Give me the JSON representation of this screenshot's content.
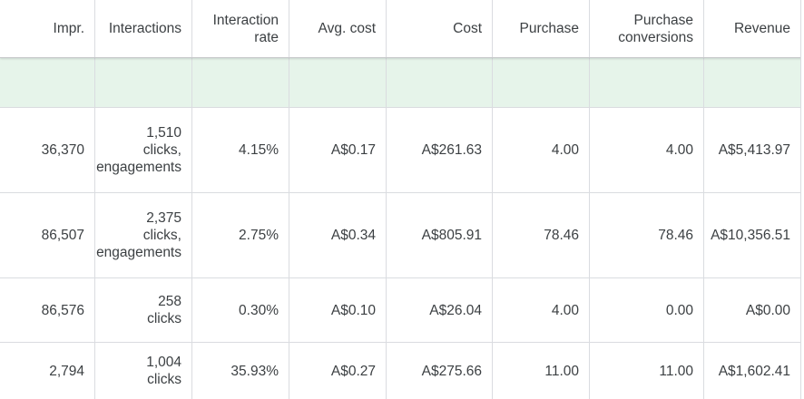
{
  "columns": [
    [
      "Impr."
    ],
    [
      "Interactions"
    ],
    [
      "Interaction",
      "rate"
    ],
    [
      "Avg. cost"
    ],
    [
      "Cost"
    ],
    [
      "Purchase"
    ],
    [
      "Purchase",
      "conversions"
    ],
    [
      "Revenue"
    ]
  ],
  "rows": [
    {
      "impr": "36,370",
      "interactions": [
        "1,510",
        "clicks,",
        "engagements"
      ],
      "interaction_rate": "4.15%",
      "avg_cost": "A$0.17",
      "cost": "A$261.63",
      "purchase": "4.00",
      "purchase_conversions": "4.00",
      "revenue": "A$5,413.97"
    },
    {
      "impr": "86,507",
      "interactions": [
        "2,375",
        "clicks,",
        "engagements"
      ],
      "interaction_rate": "2.75%",
      "avg_cost": "A$0.34",
      "cost": "A$805.91",
      "purchase": "78.46",
      "purchase_conversions": "78.46",
      "revenue": "A$10,356.51"
    },
    {
      "impr": "86,576",
      "interactions": [
        "258",
        "clicks"
      ],
      "interaction_rate": "0.30%",
      "avg_cost": "A$0.10",
      "cost": "A$26.04",
      "purchase": "4.00",
      "purchase_conversions": "0.00",
      "revenue": "A$0.00"
    },
    {
      "impr": "2,794",
      "interactions": [
        "1,004",
        "clicks"
      ],
      "interaction_rate": "35.93%",
      "avg_cost": "A$0.27",
      "cost": "A$275.66",
      "purchase": "11.00",
      "purchase_conversions": "11.00",
      "revenue": "A$1,602.41"
    }
  ],
  "colors": {
    "total_row_background": "#e6f4ea",
    "border": "#dadce0",
    "text": "#3c4043"
  }
}
